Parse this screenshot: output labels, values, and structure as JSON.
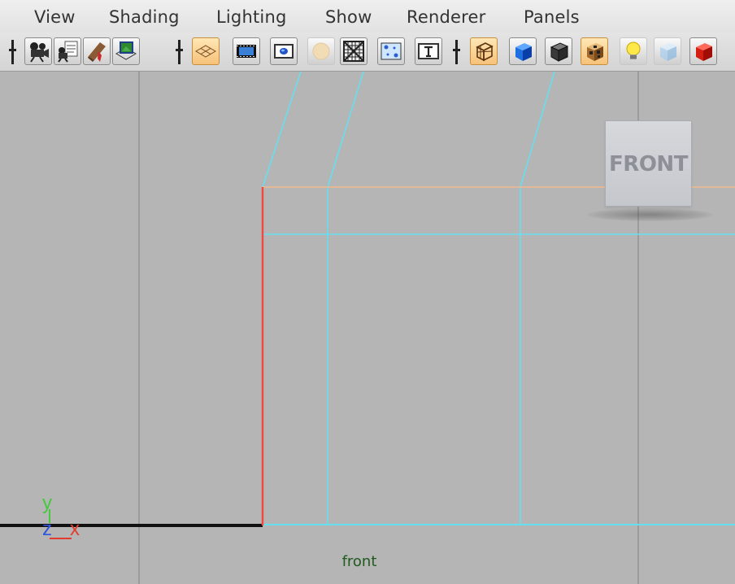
{
  "menu": {
    "view": "View",
    "shading": "Shading",
    "lighting": "Lighting",
    "show": "Show",
    "renderer": "Renderer",
    "panels": "Panels"
  },
  "toolbar": {
    "buttons": [
      {
        "icon": "camera-icon",
        "active": false
      },
      {
        "icon": "camera-attributes-icon",
        "active": false
      },
      {
        "icon": "bookmark-icon",
        "active": false
      },
      {
        "icon": "image-plane-icon",
        "active": false
      },
      {
        "icon": "grid-icon",
        "active": true
      },
      {
        "icon": "film-gate-icon",
        "active": false
      },
      {
        "icon": "resolution-gate-icon",
        "active": false
      },
      {
        "icon": "gate-mask-icon",
        "active": false
      },
      {
        "icon": "field-chart-icon",
        "active": false
      },
      {
        "icon": "safe-action-icon",
        "active": false
      },
      {
        "icon": "safe-title-icon",
        "active": false
      },
      {
        "icon": "wireframe-icon",
        "active": true
      },
      {
        "icon": "smooth-shade-icon",
        "active": false
      },
      {
        "icon": "default-material-icon",
        "active": false
      },
      {
        "icon": "textured-icon",
        "active": true
      },
      {
        "icon": "lights-icon",
        "active": false
      },
      {
        "icon": "xray-icon",
        "active": false
      },
      {
        "icon": "shaded-cube-icon",
        "active": false
      }
    ]
  },
  "viewport": {
    "viewcube_label": "FRONT",
    "camera_name": "front",
    "axis": {
      "y": "y",
      "z": "z",
      "x": "x"
    },
    "colors": {
      "background": "#b5b5b5",
      "grid_line": "#8e8e8e",
      "wire": "#66dff0",
      "selected_edge": "#f3483e",
      "highlight_edge": "#f2b98d",
      "ground_line": "#111111",
      "axis_y": "#46c93f",
      "axis_x": "#e43b2f",
      "axis_z": "#2f56dc"
    }
  }
}
